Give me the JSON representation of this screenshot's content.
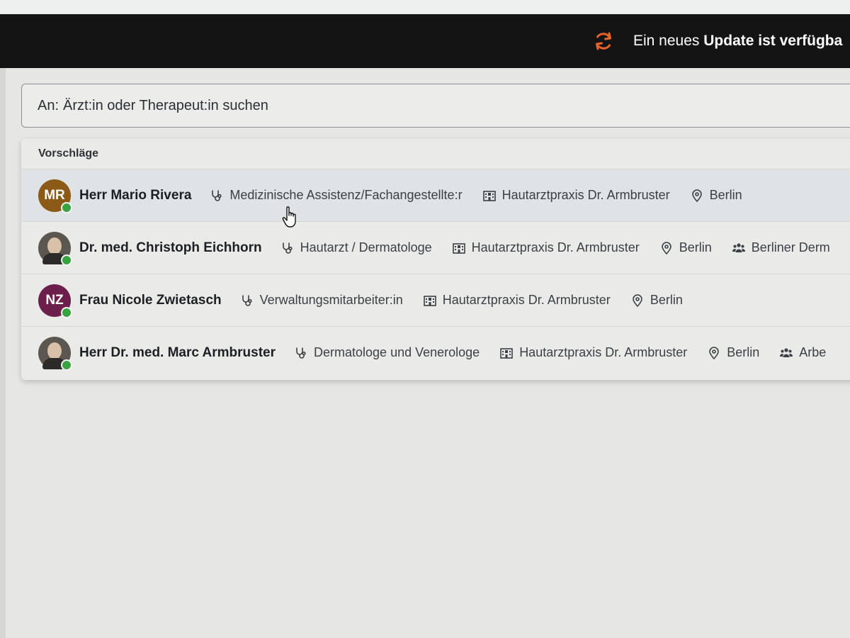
{
  "update_bar": {
    "prefix": "Ein neues",
    "bold": "Update ist verfügba",
    "icon": "refresh-icon",
    "icon_color": "#e8632b"
  },
  "search": {
    "label": "An:",
    "placeholder": "Ärzt:in oder Therapeut:in suchen"
  },
  "suggestions": {
    "header": "Vorschläge",
    "items": [
      {
        "initials": "MR",
        "avatar_color": "#8a5a16",
        "name": "Herr Mario Rivera",
        "role": "Medizinische Assistenz/Fachangestellte:r",
        "practice": "Hautarztpraxis Dr. Armbruster",
        "city": "Berlin",
        "group": ""
      },
      {
        "initials": "",
        "avatar_color": "#5c5650",
        "name": "Dr. med. Christoph Eichhorn",
        "role": "Hautarzt / Dermatologe",
        "practice": "Hautarztpraxis Dr. Armbruster",
        "city": "Berlin",
        "group": "Berliner Derm"
      },
      {
        "initials": "NZ",
        "avatar_color": "#6b1f4a",
        "name": "Frau Nicole Zwietasch",
        "role": "Verwaltungsmitarbeiter:in",
        "practice": "Hautarztpraxis Dr. Armbruster",
        "city": "Berlin",
        "group": ""
      },
      {
        "initials": "",
        "avatar_color": "#5c5650",
        "name": "Herr Dr. med. Marc Armbruster",
        "role": "Dermatologe und Venerologe",
        "practice": "Hautarztpraxis Dr. Armbruster",
        "city": "Berlin",
        "group": "Arbe"
      }
    ]
  },
  "icons": {
    "role": "stethoscope-icon",
    "practice": "building-icon",
    "city": "location-pin-icon",
    "group": "users-icon"
  },
  "colors": {
    "status_online": "#3aa341"
  }
}
